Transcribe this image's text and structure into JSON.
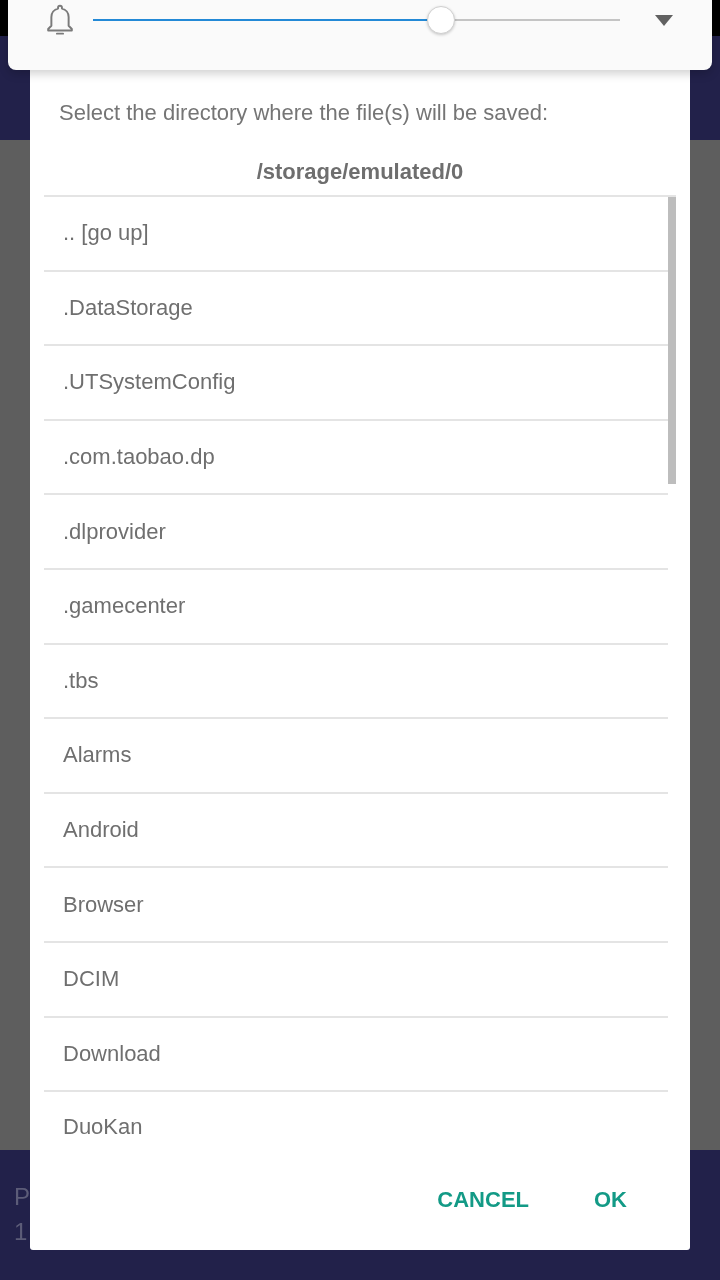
{
  "background_screen": {
    "bottom_bar_texts": [
      "P",
      "1"
    ]
  },
  "volume_panel": {
    "slider": {
      "level": 0.66
    }
  },
  "dialog": {
    "prompt": "Select the directory where the file(s) will be saved:",
    "path": "/storage/emulated/0",
    "directories": [
      ".. [go up]",
      ".DataStorage",
      ".UTSystemConfig",
      ".com.taobao.dp",
      ".dlprovider",
      ".gamecenter",
      ".tbs",
      "Alarms",
      "Android",
      "Browser",
      "DCIM",
      "Download",
      "DuoKan"
    ],
    "buttons": [
      {
        "label": "CANCEL"
      },
      {
        "label": "OK"
      }
    ]
  }
}
